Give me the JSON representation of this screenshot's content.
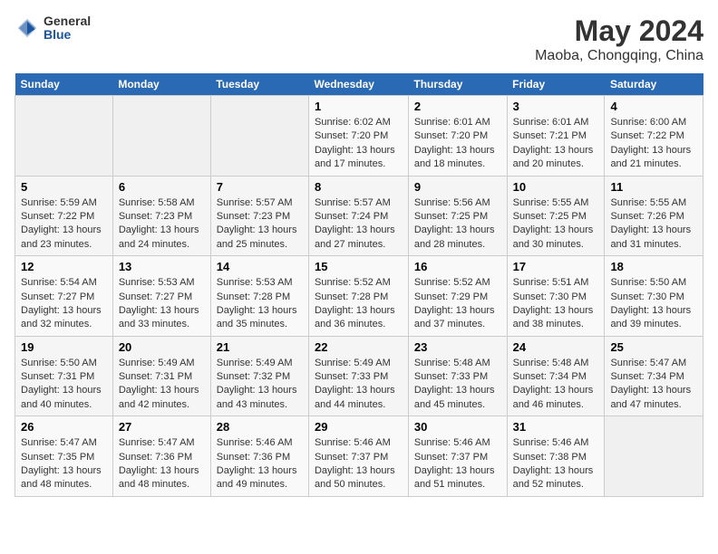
{
  "header": {
    "logo_general": "General",
    "logo_blue": "Blue",
    "title": "May 2024",
    "subtitle": "Maoba, Chongqing, China"
  },
  "days_of_week": [
    "Sunday",
    "Monday",
    "Tuesday",
    "Wednesday",
    "Thursday",
    "Friday",
    "Saturday"
  ],
  "weeks": [
    [
      {
        "day": "",
        "empty": true
      },
      {
        "day": "",
        "empty": true
      },
      {
        "day": "",
        "empty": true
      },
      {
        "day": "1",
        "sunrise": "6:02 AM",
        "sunset": "7:20 PM",
        "daylight": "13 hours and 17 minutes."
      },
      {
        "day": "2",
        "sunrise": "6:01 AM",
        "sunset": "7:20 PM",
        "daylight": "13 hours and 18 minutes."
      },
      {
        "day": "3",
        "sunrise": "6:01 AM",
        "sunset": "7:21 PM",
        "daylight": "13 hours and 20 minutes."
      },
      {
        "day": "4",
        "sunrise": "6:00 AM",
        "sunset": "7:22 PM",
        "daylight": "13 hours and 21 minutes."
      }
    ],
    [
      {
        "day": "5",
        "sunrise": "5:59 AM",
        "sunset": "7:22 PM",
        "daylight": "13 hours and 23 minutes."
      },
      {
        "day": "6",
        "sunrise": "5:58 AM",
        "sunset": "7:23 PM",
        "daylight": "13 hours and 24 minutes."
      },
      {
        "day": "7",
        "sunrise": "5:57 AM",
        "sunset": "7:23 PM",
        "daylight": "13 hours and 25 minutes."
      },
      {
        "day": "8",
        "sunrise": "5:57 AM",
        "sunset": "7:24 PM",
        "daylight": "13 hours and 27 minutes."
      },
      {
        "day": "9",
        "sunrise": "5:56 AM",
        "sunset": "7:25 PM",
        "daylight": "13 hours and 28 minutes."
      },
      {
        "day": "10",
        "sunrise": "5:55 AM",
        "sunset": "7:25 PM",
        "daylight": "13 hours and 30 minutes."
      },
      {
        "day": "11",
        "sunrise": "5:55 AM",
        "sunset": "7:26 PM",
        "daylight": "13 hours and 31 minutes."
      }
    ],
    [
      {
        "day": "12",
        "sunrise": "5:54 AM",
        "sunset": "7:27 PM",
        "daylight": "13 hours and 32 minutes."
      },
      {
        "day": "13",
        "sunrise": "5:53 AM",
        "sunset": "7:27 PM",
        "daylight": "13 hours and 33 minutes."
      },
      {
        "day": "14",
        "sunrise": "5:53 AM",
        "sunset": "7:28 PM",
        "daylight": "13 hours and 35 minutes."
      },
      {
        "day": "15",
        "sunrise": "5:52 AM",
        "sunset": "7:28 PM",
        "daylight": "13 hours and 36 minutes."
      },
      {
        "day": "16",
        "sunrise": "5:52 AM",
        "sunset": "7:29 PM",
        "daylight": "13 hours and 37 minutes."
      },
      {
        "day": "17",
        "sunrise": "5:51 AM",
        "sunset": "7:30 PM",
        "daylight": "13 hours and 38 minutes."
      },
      {
        "day": "18",
        "sunrise": "5:50 AM",
        "sunset": "7:30 PM",
        "daylight": "13 hours and 39 minutes."
      }
    ],
    [
      {
        "day": "19",
        "sunrise": "5:50 AM",
        "sunset": "7:31 PM",
        "daylight": "13 hours and 40 minutes."
      },
      {
        "day": "20",
        "sunrise": "5:49 AM",
        "sunset": "7:31 PM",
        "daylight": "13 hours and 42 minutes."
      },
      {
        "day": "21",
        "sunrise": "5:49 AM",
        "sunset": "7:32 PM",
        "daylight": "13 hours and 43 minutes."
      },
      {
        "day": "22",
        "sunrise": "5:49 AM",
        "sunset": "7:33 PM",
        "daylight": "13 hours and 44 minutes."
      },
      {
        "day": "23",
        "sunrise": "5:48 AM",
        "sunset": "7:33 PM",
        "daylight": "13 hours and 45 minutes."
      },
      {
        "day": "24",
        "sunrise": "5:48 AM",
        "sunset": "7:34 PM",
        "daylight": "13 hours and 46 minutes."
      },
      {
        "day": "25",
        "sunrise": "5:47 AM",
        "sunset": "7:34 PM",
        "daylight": "13 hours and 47 minutes."
      }
    ],
    [
      {
        "day": "26",
        "sunrise": "5:47 AM",
        "sunset": "7:35 PM",
        "daylight": "13 hours and 48 minutes."
      },
      {
        "day": "27",
        "sunrise": "5:47 AM",
        "sunset": "7:36 PM",
        "daylight": "13 hours and 48 minutes."
      },
      {
        "day": "28",
        "sunrise": "5:46 AM",
        "sunset": "7:36 PM",
        "daylight": "13 hours and 49 minutes."
      },
      {
        "day": "29",
        "sunrise": "5:46 AM",
        "sunset": "7:37 PM",
        "daylight": "13 hours and 50 minutes."
      },
      {
        "day": "30",
        "sunrise": "5:46 AM",
        "sunset": "7:37 PM",
        "daylight": "13 hours and 51 minutes."
      },
      {
        "day": "31",
        "sunrise": "5:46 AM",
        "sunset": "7:38 PM",
        "daylight": "13 hours and 52 minutes."
      },
      {
        "day": "",
        "empty": true
      }
    ]
  ]
}
